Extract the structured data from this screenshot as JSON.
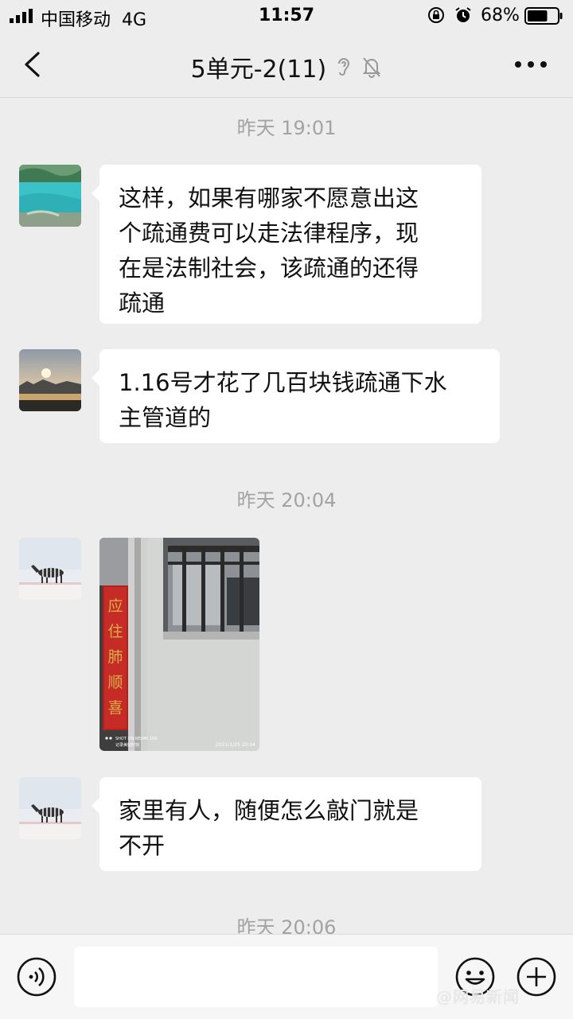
{
  "status_bar": {
    "carrier": "中国移动",
    "network": "4G",
    "time": "11:57",
    "battery_percent": "68%",
    "battery_level": 0.68
  },
  "header": {
    "title": "5单元-2(11)",
    "icons": [
      "back-icon",
      "ear-icon",
      "mute-bell-icon",
      "more-icon"
    ]
  },
  "messages": [
    {
      "type": "timestamp",
      "text": "昨天 19:01"
    },
    {
      "type": "text",
      "avatar": "lake-avatar",
      "lines": [
        "这样，如果有哪家不愿意出这",
        "个疏通费可以走法律程序，现",
        "在是法制社会，该疏通的还得",
        "疏通"
      ]
    },
    {
      "type": "text",
      "avatar": "sunset-avatar",
      "lines": [
        "1.16号才花了几百块钱疏通下水",
        "主管道的"
      ]
    },
    {
      "type": "timestamp",
      "text": "昨天 20:04"
    },
    {
      "type": "image",
      "avatar": "zebra-avatar",
      "photo": {
        "couplet_text": "应住肺顺喜",
        "camera_line1": "SHOT ON REDMI 10X",
        "camera_line2": "记录美好时刻",
        "photo_datetime": "2021/1/25  20:04"
      }
    },
    {
      "type": "text",
      "avatar": "zebra-avatar",
      "lines": [
        "家里有人，随便怎么敲门就是",
        "不开"
      ]
    },
    {
      "type": "timestamp",
      "text": "昨天 20:06"
    }
  ],
  "input_bar": {
    "value": "",
    "icons": [
      "voice-icon",
      "emoji-icon",
      "plus-icon"
    ]
  },
  "watermark": "@网易新闻"
}
